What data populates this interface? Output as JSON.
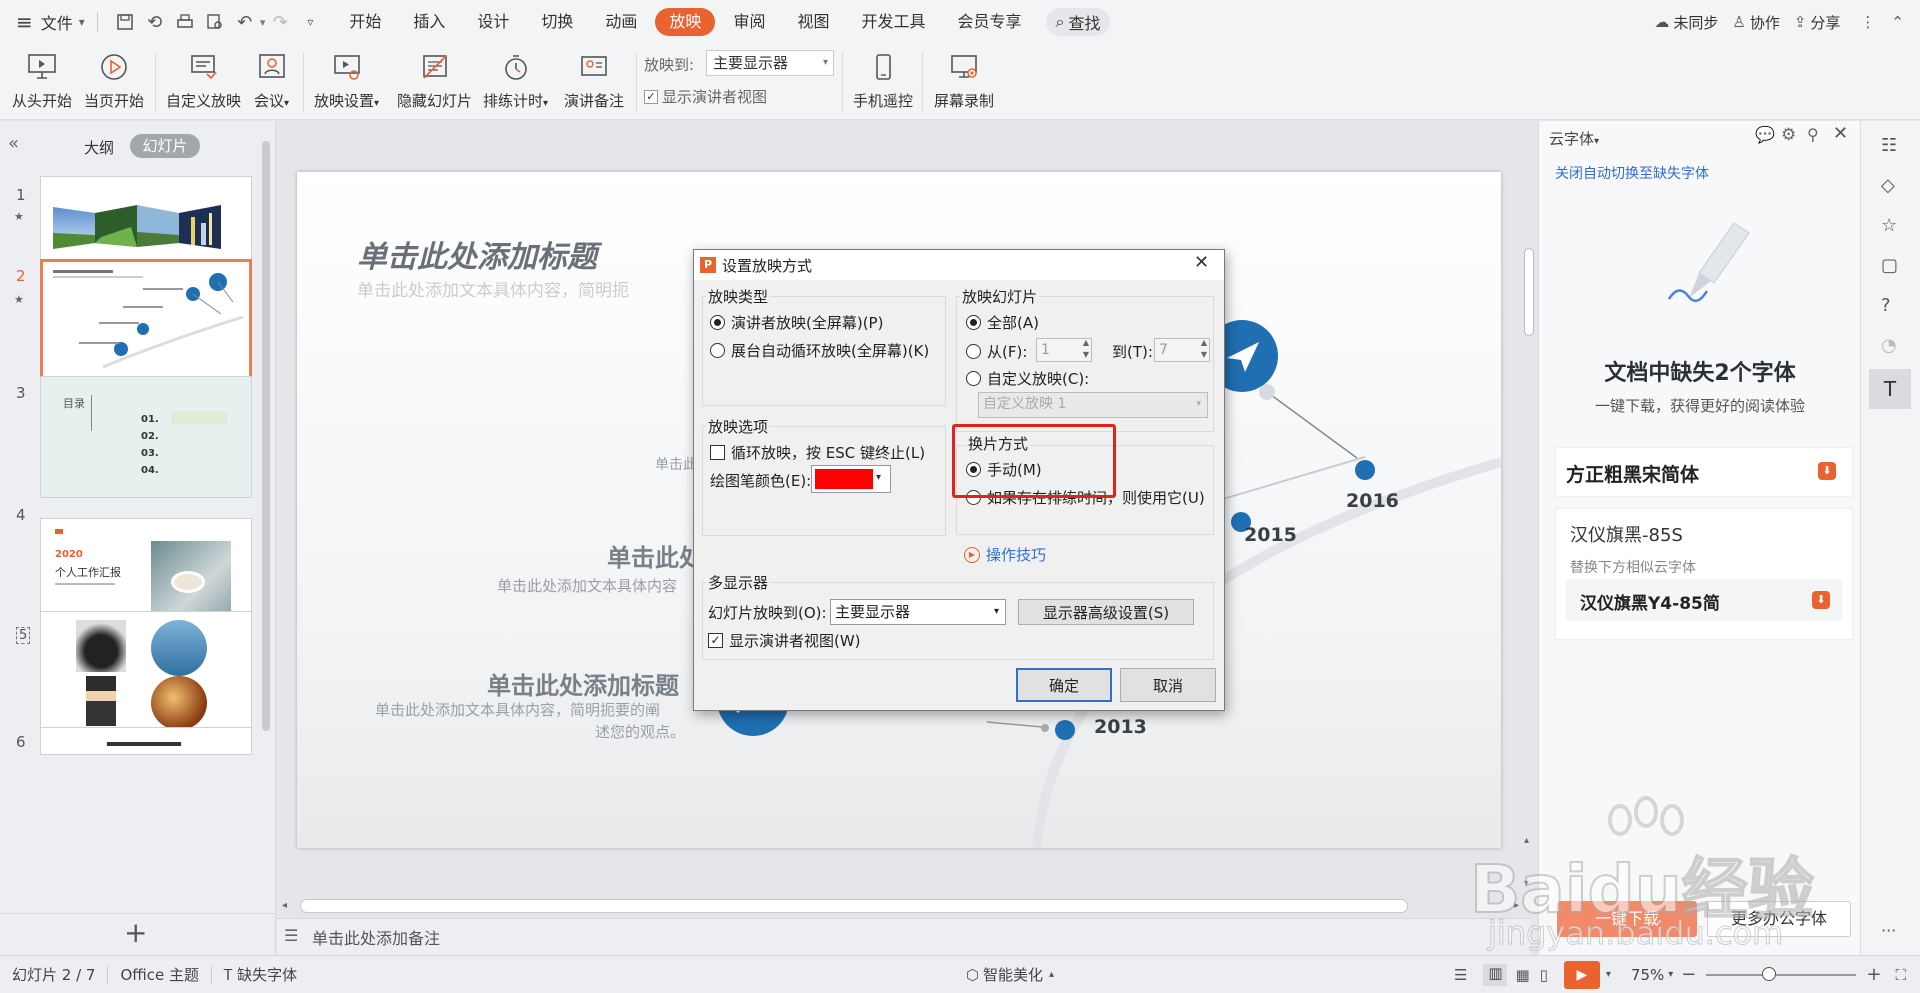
{
  "menu": {
    "file": "文件",
    "tabs": [
      "开始",
      "插入",
      "设计",
      "切换",
      "动画",
      "放映",
      "审阅",
      "视图",
      "开发工具",
      "会员专享"
    ],
    "active_tab": "放映",
    "search": "查找",
    "sync": "未同步",
    "collab": "协作",
    "share": "分享"
  },
  "ribbon": {
    "buttons": [
      "从头开始",
      "当页开始",
      "自定义放映",
      "会议",
      "放映设置",
      "隐藏幻灯片",
      "排练计时",
      "演讲备注",
      "手机遥控",
      "屏幕录制"
    ],
    "show_to_label": "放映到:",
    "show_to_value": "主要显示器",
    "presenter_view": "显示演讲者视图"
  },
  "left_panel": {
    "tab_outline": "大纲",
    "tab_slides": "幻灯片",
    "slide_numbers": [
      "1",
      "2",
      "3",
      "4",
      "5",
      "6"
    ],
    "add_icon": "plus-icon",
    "thumb3": {
      "title": "目录",
      "items": [
        "01.",
        "02.",
        "03.",
        "04."
      ]
    },
    "thumb4": {
      "year": "2020",
      "title": "个人工作汇报"
    }
  },
  "slide": {
    "title": "单击此处添加标题",
    "subtitle": "单击此处添加文本具体内容，简明扼",
    "block1_title": "单击此处",
    "block1_text": "单击此处添加文本具体内容",
    "block2_title": "单击此处添加标题",
    "block2_text1": "单击此处添加文本具体内容，简明扼要的阐",
    "block2_text2": "述您的观点。",
    "years": [
      "2013",
      "2015",
      "2016"
    ],
    "small_text": "单击此"
  },
  "notes_placeholder": "单击此处添加备注",
  "dialog": {
    "title": "设置放映方式",
    "show_type": {
      "label": "放映类型",
      "options": [
        "演讲者放映(全屏幕)(P)",
        "展台自动循环放映(全屏幕)(K)"
      ]
    },
    "show_slides": {
      "label": "放映幻灯片",
      "all": "全部(A)",
      "from": "从(F):",
      "from_value": "1",
      "to": "到(T):",
      "to_value": "7",
      "custom": "自定义放映(C):",
      "custom_value": "自定义放映 1"
    },
    "options": {
      "label": "放映选项",
      "loop": "循环放映，按 ESC 键终止(L)",
      "pen_color": "绘图笔颜色(E):",
      "pen_color_value": "#ff0000"
    },
    "advance": {
      "label": "换片方式",
      "manual": "手动(M)",
      "timings": "如果存在排练时间，则使用它(U)"
    },
    "tips": "操作技巧",
    "multi": {
      "label": "多显示器",
      "show_on": "幻灯片放映到(O):",
      "monitor": "主要显示器",
      "advanced": "显示器高级设置(S)",
      "presenter": "显示演讲者视图(W)"
    },
    "ok": "确定",
    "cancel": "取消"
  },
  "right_panel": {
    "header": "云字体",
    "link": "关闭自动切换至缺失字体",
    "headline": "文档中缺失2个字体",
    "sub": "一键下载，获得更好的阅读体验",
    "font1": "方正粗黑宋简体",
    "font2": "汉仪旗黑-85S",
    "replace_hint": "替换下方相似云字体",
    "font2_alt": "汉仪旗黑Y4-85简",
    "download": "一键下载",
    "more": "更多办公字体"
  },
  "status": {
    "slide": "幻灯片 2 / 7",
    "theme": "Office 主题",
    "missing_font": "缺失字体",
    "beautify": "智能美化",
    "zoom": "75%"
  },
  "watermark": {
    "brand": "Baidu经验",
    "url": "jingyan.baidu.com"
  },
  "colors": {
    "accent": "#e9622f",
    "blue": "#1f6fb2",
    "link": "#2f6fd0",
    "highlight_box": "#e0231c"
  }
}
